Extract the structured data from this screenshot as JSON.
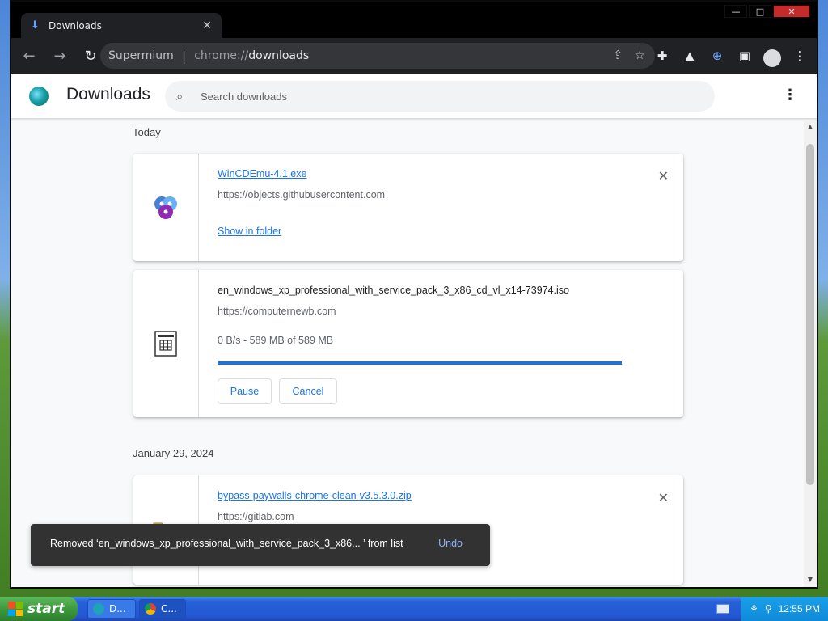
{
  "browser": {
    "tab_title": "Downloads",
    "tab_icon": "download-icon",
    "window_controls": {
      "minimize": "—",
      "maximize": "□",
      "close": "✕"
    },
    "omnibox": {
      "site_label": "Supermium",
      "url_scheme": "chrome://",
      "url_path": "downloads"
    },
    "nav": {
      "back": "←",
      "forward": "→",
      "reload": "↻"
    }
  },
  "downloads_page": {
    "title": "Downloads",
    "search_placeholder": "Search downloads",
    "sections": [
      {
        "date": "Today",
        "items": [
          {
            "file_name": "WinCDEmu-4.1.exe",
            "source": "https://objects.githubusercontent.com",
            "action": "Show in folder",
            "icon": "wincdemu-icon"
          },
          {
            "file_name": "en_windows_xp_professional_with_service_pack_3_x86_cd_vl_x14-73974.iso",
            "source": "https://computernewb.com",
            "status": "0 B/s - 589 MB of 589 MB",
            "progress_percent": 100,
            "buttons": {
              "pause": "Pause",
              "cancel": "Cancel"
            },
            "icon": "iso-file-icon"
          }
        ]
      },
      {
        "date": "January 29, 2024",
        "items": [
          {
            "file_name": "bypass-paywalls-chrome-clean-v3.5.3.0.zip",
            "source": "https://gitlab.com",
            "icon": "zip-folder-icon"
          }
        ]
      }
    ],
    "toast": {
      "message": "Removed ‘en_windows_xp_professional_with_service_pack_3_x86... ’ from list",
      "action": "Undo"
    }
  },
  "taskbar": {
    "start_label": "start",
    "tasks": [
      {
        "label": "D...",
        "icon": "edge-icon"
      },
      {
        "label": "C...",
        "icon": "chrome-icon"
      }
    ],
    "clock": "12:55 PM"
  },
  "colors": {
    "accent": "#1a73e8",
    "toast_bg": "#323232",
    "taskbar": "#2458d2",
    "start_green": "#3c9a3c"
  }
}
